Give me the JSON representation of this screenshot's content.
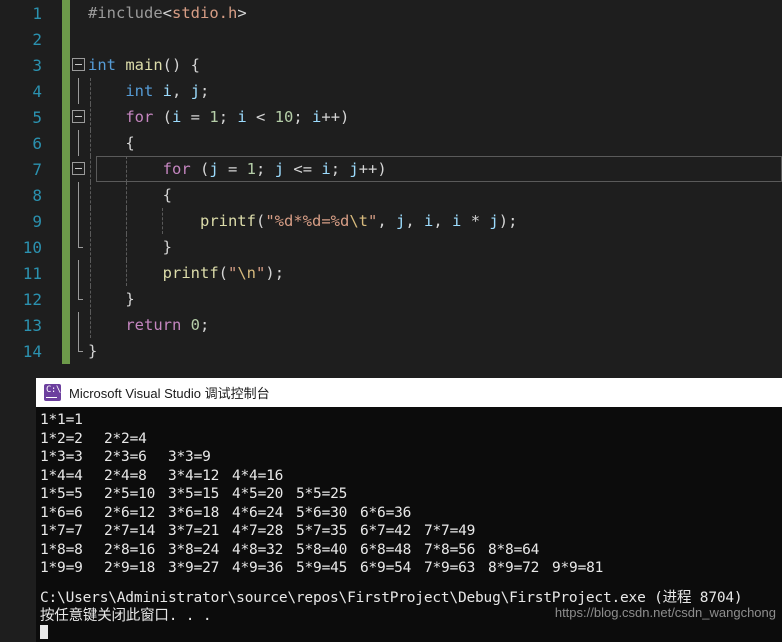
{
  "editor": {
    "name": "visual-studio-code-editor",
    "theme_background": "#1e1e1e",
    "line_number_color": "#2b91af",
    "change_bar_color": "#6d9a4a",
    "lines": [
      {
        "n": "1",
        "text": "#include<stdio.h>"
      },
      {
        "n": "2",
        "text": ""
      },
      {
        "n": "3",
        "text": "int main() {"
      },
      {
        "n": "4",
        "text": "    int i, j;"
      },
      {
        "n": "5",
        "text": "    for (i = 1; i < 10; i++)"
      },
      {
        "n": "6",
        "text": "    {"
      },
      {
        "n": "7",
        "text": "        for (j = 1; j <= i; j++)"
      },
      {
        "n": "8",
        "text": "        {"
      },
      {
        "n": "9",
        "text": "            printf(\"%d*%d=%d\\t\", j, i, i * j);"
      },
      {
        "n": "10",
        "text": "        }"
      },
      {
        "n": "11",
        "text": "        printf(\"\\n\");"
      },
      {
        "n": "12",
        "text": "    }"
      },
      {
        "n": "13",
        "text": "    return 0;"
      },
      {
        "n": "14",
        "text": "}"
      }
    ]
  },
  "console": {
    "title": "Microsoft Visual Studio 调试控制台",
    "icon": "console-window-icon",
    "icon_label": "C:\\",
    "background": "#0c0c0c",
    "titlebar_background": "#ffffff",
    "text_color": "#e8e8e8",
    "output_rows": [
      [
        "1*1=1"
      ],
      [
        "1*2=2",
        "2*2=4"
      ],
      [
        "1*3=3",
        "2*3=6",
        "3*3=9"
      ],
      [
        "1*4=4",
        "2*4=8",
        "3*4=12",
        "4*4=16"
      ],
      [
        "1*5=5",
        "2*5=10",
        "3*5=15",
        "4*5=20",
        "5*5=25"
      ],
      [
        "1*6=6",
        "2*6=12",
        "3*6=18",
        "4*6=24",
        "5*6=30",
        "6*6=36"
      ],
      [
        "1*7=7",
        "2*7=14",
        "3*7=21",
        "4*7=28",
        "5*7=35",
        "6*7=42",
        "7*7=49"
      ],
      [
        "1*8=8",
        "2*8=16",
        "3*8=24",
        "4*8=32",
        "5*8=40",
        "6*8=48",
        "7*8=56",
        "8*8=64"
      ],
      [
        "1*9=9",
        "2*9=18",
        "3*9=27",
        "4*9=36",
        "5*9=45",
        "6*9=54",
        "7*9=63",
        "8*9=72",
        "9*9=81"
      ]
    ],
    "exit_line": "C:\\Users\\Administrator\\source\\repos\\FirstProject\\Debug\\FirstProject.exe (进程 8704)",
    "prompt_line": "按任意键关闭此窗口. . ."
  },
  "watermark": {
    "url": "https://blog.csdn.net/csdn_wangchong"
  }
}
